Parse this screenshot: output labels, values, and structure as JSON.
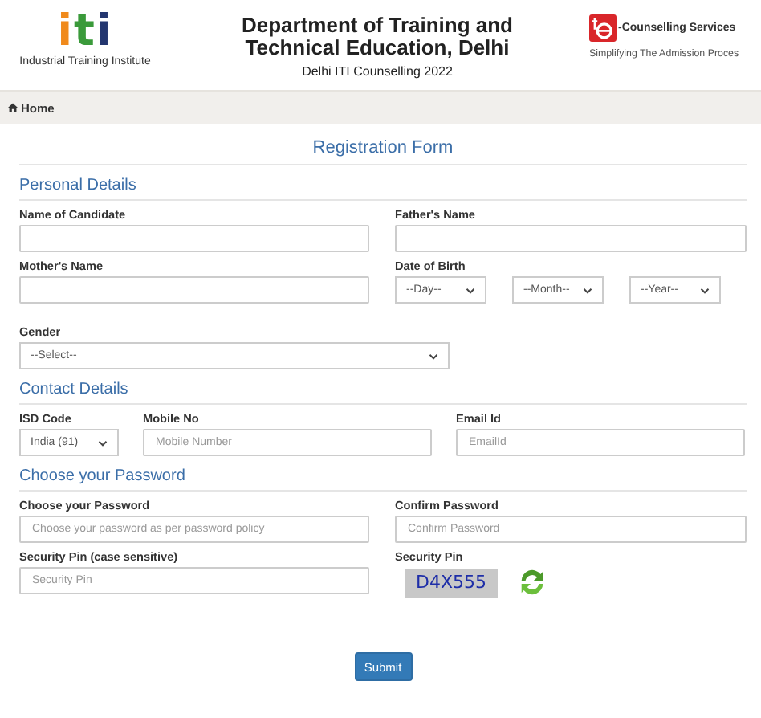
{
  "header": {
    "logo": {
      "mark": "iti",
      "caption": "Industrial Training Institute"
    },
    "title": "Department of Training and Technical Education, Delhi",
    "subtitle": "Delhi ITI Counselling 2022",
    "brand": {
      "name": "-Counselling Services",
      "tagline": "Simplifying The Admission Proces"
    }
  },
  "nav": {
    "home": "Home"
  },
  "form": {
    "title": "Registration Form",
    "sections": [
      {
        "heading": "Personal Details",
        "rows": [
          [
            {
              "kind": "input",
              "label": "Name of Candidate"
            },
            {
              "kind": "input",
              "label": "Father's Name"
            }
          ],
          [
            {
              "kind": "input",
              "label": "Mother's Name"
            },
            {
              "kind": "date",
              "label": "Date of Birth",
              "parts": [
                "--Day--",
                "--Month--",
                "--Year--"
              ]
            }
          ],
          [
            {
              "kind": "select",
              "label": "Gender",
              "value": "--Select--"
            }
          ]
        ]
      },
      {
        "heading": "Contact Details",
        "rows": [
          [
            {
              "kind": "select",
              "label": "ISD Code",
              "value": "India (91)"
            },
            {
              "kind": "input",
              "label": "Mobile No",
              "placeholder": "Mobile Number"
            },
            {
              "kind": "input",
              "label": "Email Id",
              "placeholder": "EmailId"
            }
          ]
        ]
      },
      {
        "heading": "Choose your Password",
        "rows": [
          [
            {
              "kind": "input",
              "label": "Choose your Password",
              "placeholder": "Choose your password as per password policy"
            },
            {
              "kind": "input",
              "label": "Confirm Password",
              "placeholder": "Confirm Password"
            }
          ],
          [
            {
              "kind": "input",
              "label": "Security Pin (case sensitive)",
              "placeholder": "Security Pin"
            },
            {
              "kind": "captcha",
              "label": "Security Pin",
              "code": "D4X555"
            }
          ]
        ]
      }
    ],
    "submit": "Submit"
  }
}
